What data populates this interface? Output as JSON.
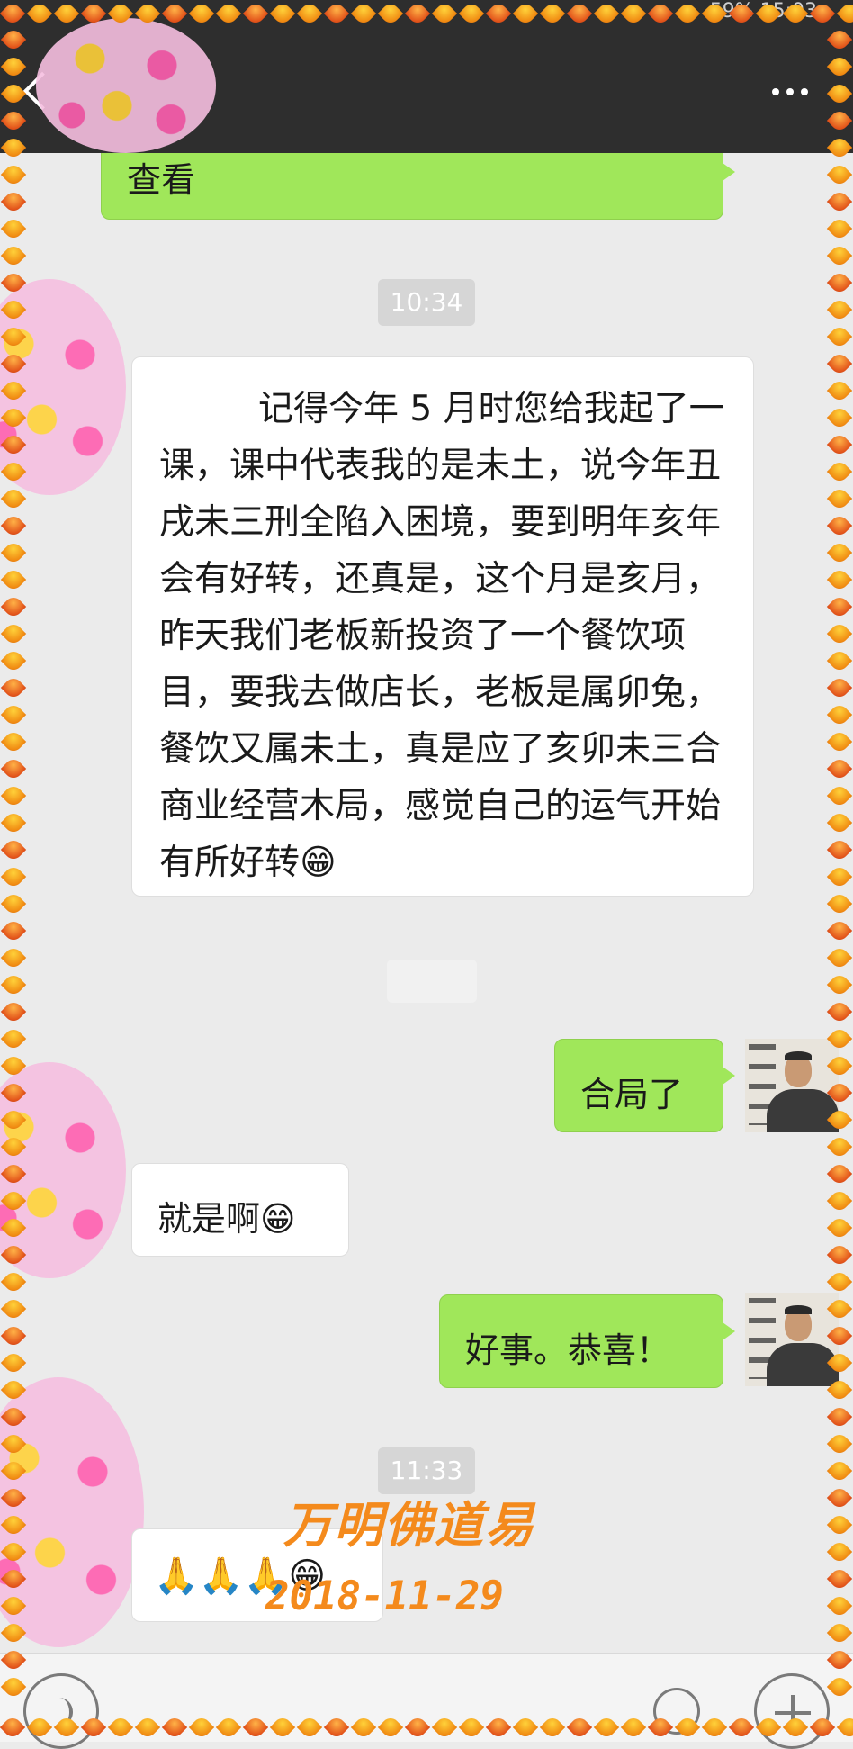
{
  "status_bar": {
    "text": "59% 15:03"
  },
  "header": {
    "back_icon": "back-chevron-icon",
    "more_icon": "more-dots-icon"
  },
  "messages": {
    "view_label": "查看",
    "time1": "10:34",
    "msg1": "记得今年 5 月时您给我起了一课，课中代表我的是未土，说今年丑戌未三刑全陷入困境，要到明年亥年会有好转，还真是，这个月是亥月，昨天我们老板新投资了一个餐饮项目，要我去做店长，老板是属卯兔，餐饮又属未土，真是应了亥卯未三合商业经营木局，感觉自己的运气开始有所好转😁",
    "reply1": "合局了",
    "msg2": "就是啊😁",
    "reply2": "好事。恭喜！",
    "time2": "11:33",
    "msg3": "🙏🙏🙏😁"
  },
  "watermark": {
    "name": "万明佛道易",
    "date": "2018-11-29"
  },
  "bottom_bar": {
    "voice_icon": "voice-icon",
    "emoji_icon": "emoji-icon",
    "plus_icon": "plus-icon"
  },
  "colors": {
    "header_bg": "#2e2e2e",
    "chat_bg": "#ebebeb",
    "sent_bubble": "#a0e75a",
    "received_bubble": "#ffffff",
    "watermark": "#f48a1c"
  }
}
